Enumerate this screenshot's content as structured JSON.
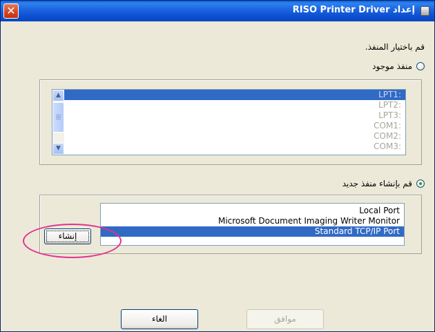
{
  "window": {
    "title": "إعداد RISO Printer Driver",
    "close_glyph": "✕"
  },
  "prompt": "قم باختيار المنفذ.",
  "existing_port": {
    "label": "منفذ موجود",
    "selected": false,
    "ports": [
      "LPT1:",
      "LPT2:",
      "LPT3:",
      "COM1:",
      "COM2:",
      "COM3:"
    ],
    "selected_index": 0
  },
  "new_port": {
    "label": "قم بإنشاء منفذ جديد",
    "selected": true,
    "types": [
      "Local Port",
      "Microsoft Document Imaging Writer Monitor",
      "Standard TCP/IP Port"
    ],
    "selected_index": 2,
    "create_button": "إنشاء"
  },
  "buttons": {
    "ok": "موافق",
    "cancel": "الغاء"
  },
  "colors": {
    "titlebar": "#0c4fd0",
    "selection": "#316ac5",
    "highlight_annotation": "#e3318f"
  }
}
